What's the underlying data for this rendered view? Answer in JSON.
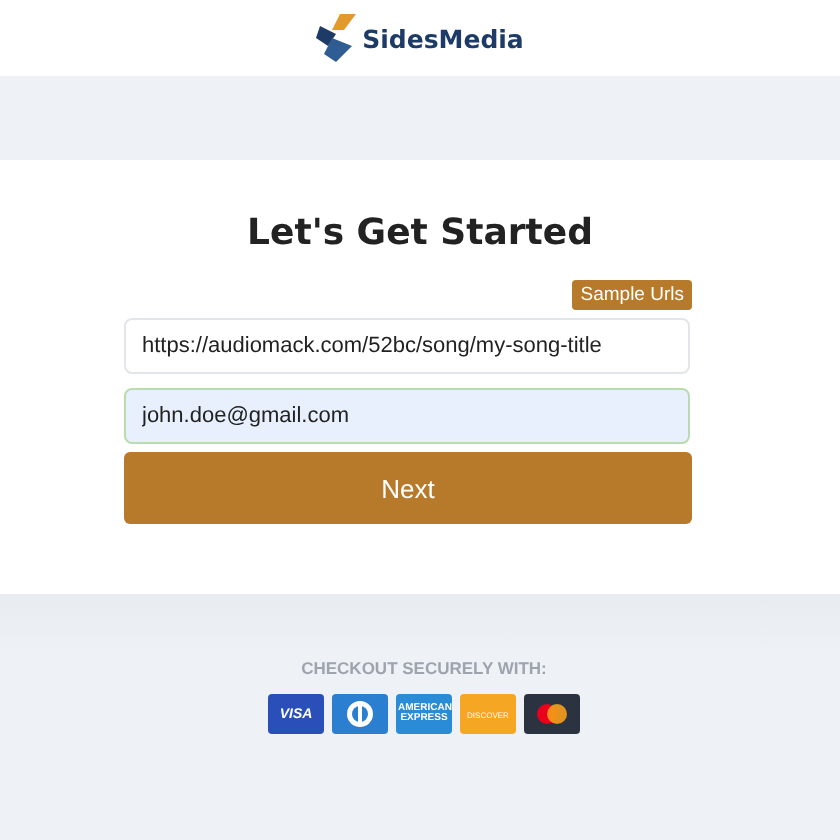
{
  "header": {
    "brand": "SidesMedia"
  },
  "form": {
    "title": "Let's Get Started",
    "sample_link": "Sample Urls",
    "url_value": "https://audiomack.com/52bc/song/my-song-title",
    "email_value": "john.doe@gmail.com",
    "submit": "Next"
  },
  "checkout": {
    "heading": "CHECKOUT SECURELY WITH:",
    "cards": [
      {
        "kind": "visa",
        "label": "VISA"
      },
      {
        "kind": "diners"
      },
      {
        "kind": "amex",
        "label": "AMERICAN EXPRESS"
      },
      {
        "kind": "discover",
        "label": "DISCOVER"
      },
      {
        "kind": "mastercard"
      }
    ]
  }
}
